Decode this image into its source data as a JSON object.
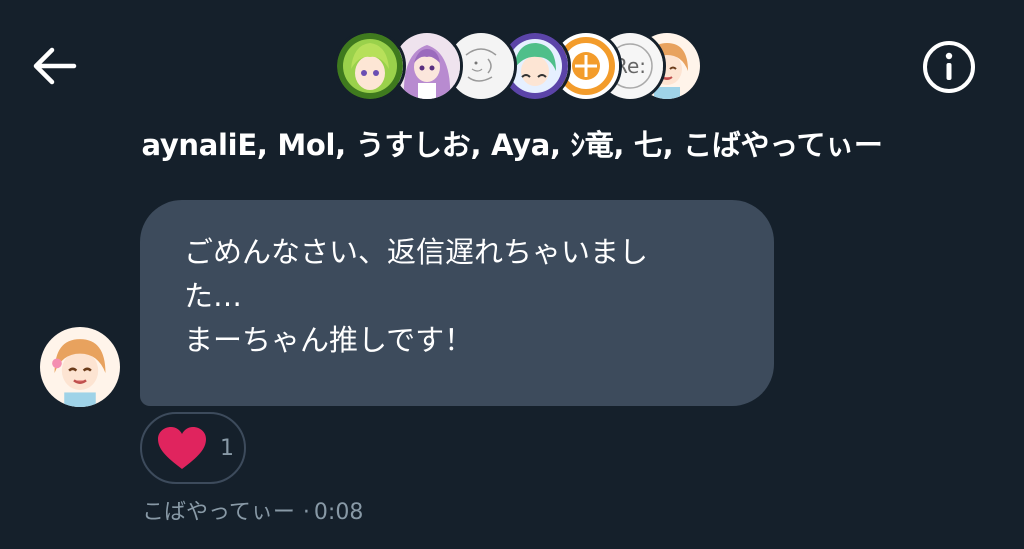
{
  "header": {
    "participants_label": "aynaliE, Mol, うすしお, Aya, ｼ竜, 七, こばやってぃー",
    "avatars": [
      {
        "name": "aynaliE",
        "icon": "green-hair-character-avatar",
        "color": "#7fc241"
      },
      {
        "name": "Mol",
        "icon": "purple-hair-character-avatar",
        "color": "#c9a0d8"
      },
      {
        "name": "うすしお",
        "icon": "sketch-avatar",
        "color": "#f2f2f2"
      },
      {
        "name": "Aya",
        "icon": "green-hair-purple-frame-avatar",
        "color": "#6a4fb3"
      },
      {
        "name": "ｼ竜",
        "icon": "orange-emblem-avatar",
        "color": "#f39c2b"
      },
      {
        "name": "七",
        "icon": "re-logo-avatar",
        "color": "#f5f5f5"
      },
      {
        "name": "こばやってぃー",
        "icon": "orange-hair-character-avatar",
        "color": "#f0b27a"
      }
    ]
  },
  "message": {
    "lines": [
      "ごめんなさい、返信遅れちゃいまし",
      "た…",
      "まーちゃん推しです！"
    ],
    "sender": "こばやってぃー",
    "separator": "·",
    "time": "0:08",
    "reaction": {
      "icon": "heart-icon",
      "count": "1",
      "color": "#e0245e"
    }
  },
  "colors": {
    "background": "#15202b",
    "bubble": "#3d4b5c",
    "muted_text": "#8899a6"
  }
}
